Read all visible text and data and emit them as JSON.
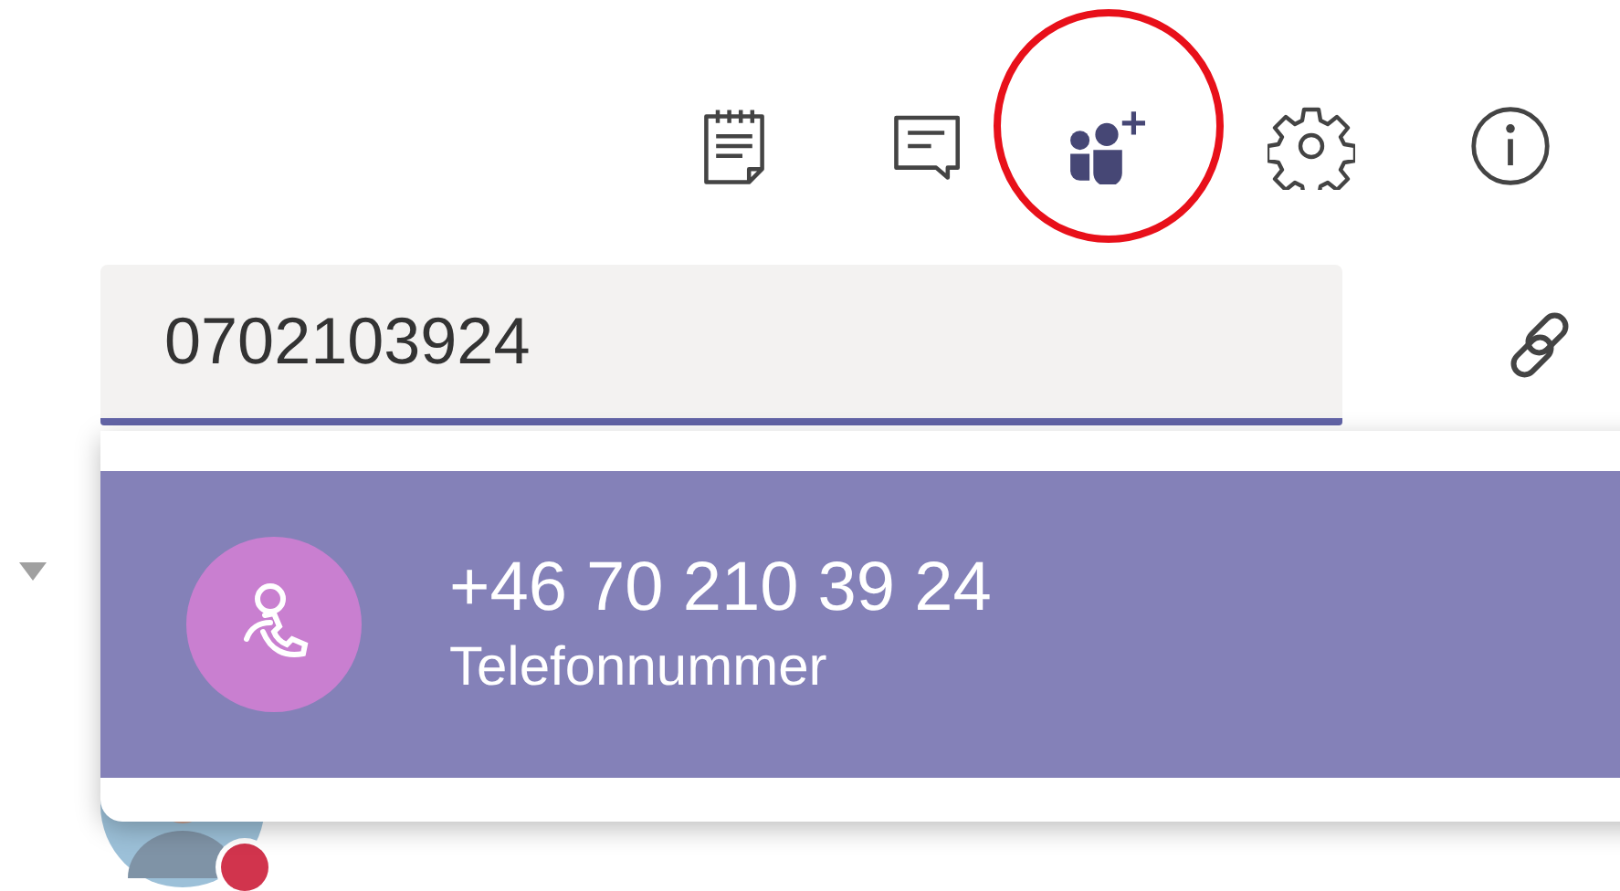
{
  "search": {
    "value": "0702103924"
  },
  "suggestions": [
    {
      "title": "+46 70 210 39 24",
      "subtitle": "Telefonnummer",
      "selected": true
    }
  ]
}
